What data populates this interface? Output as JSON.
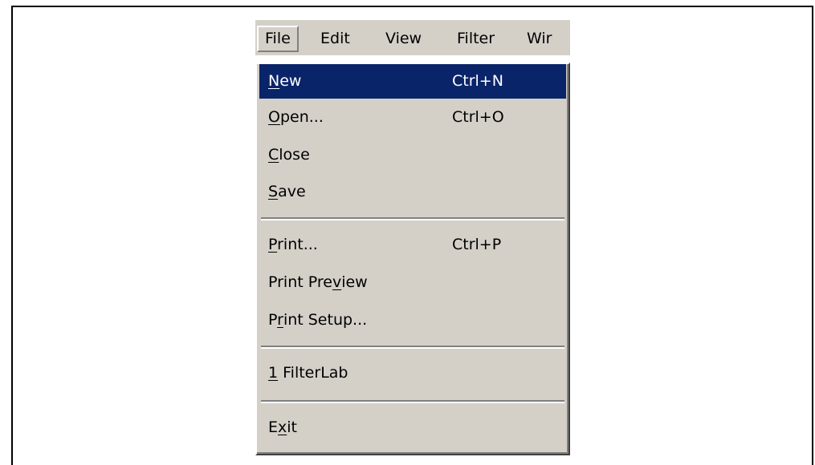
{
  "menubar": {
    "items": [
      {
        "label": "File",
        "active": true
      },
      {
        "label": "Edit"
      },
      {
        "label": "View"
      },
      {
        "label": "Filter"
      },
      {
        "label": "Wir"
      }
    ]
  },
  "file_menu": {
    "items": [
      {
        "mnemonic": "N",
        "rest": "ew",
        "shortcut": "Ctrl+N",
        "highlighted": true
      },
      {
        "mnemonic": "O",
        "rest": "pen...",
        "shortcut": "Ctrl+O"
      },
      {
        "mnemonic": "C",
        "rest": "lose",
        "shortcut": ""
      },
      {
        "mnemonic": "S",
        "rest": "ave",
        "shortcut": ""
      },
      {
        "mnemonic": "P",
        "rest": "rint...",
        "shortcut": "Ctrl+P"
      },
      {
        "pre": "Print Pre",
        "mnemonic": "v",
        "rest": "iew",
        "shortcut": ""
      },
      {
        "pre": "P",
        "mnemonic": "r",
        "rest": "int Setup...",
        "shortcut": ""
      },
      {
        "mnemonic": "1",
        "rest": " FilterLab",
        "shortcut": ""
      },
      {
        "pre": "E",
        "mnemonic": "x",
        "rest": "it",
        "shortcut": ""
      }
    ]
  },
  "colors": {
    "menu_background": "#d4d0c8",
    "highlight": "#0a246a",
    "highlight_text": "#ffffff"
  }
}
